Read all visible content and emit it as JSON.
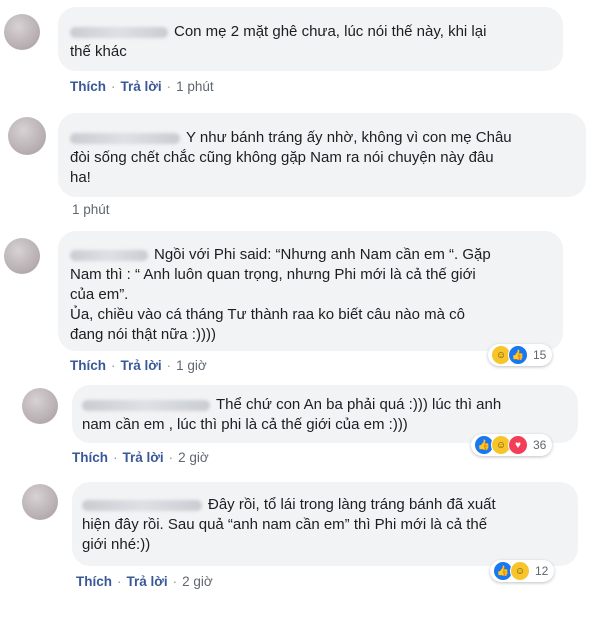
{
  "labels": {
    "like": "Thích",
    "reply": "Trả lời"
  },
  "comments": [
    {
      "text": "Con mẹ 2 mặt ghê chưa, lúc nói thế này, khi lại\nthế khác",
      "time": "1 phút",
      "show_actions": true
    },
    {
      "text": "Y như bánh tráng ấy nhờ, không vì con mẹ Châu\nđòi sống chết chắc cũng không gặp Nam ra nói chuyện này đâu\nha!",
      "time": "1 phút",
      "show_actions": false
    },
    {
      "text": "Ngồi với Phi said: “Nhưng anh Nam cần em “. Gặp\nNam thì : “ Anh luôn quan trọng, nhưng Phi mới là cả thế giới\ncủa em”.\nỦa, chiều vào cá tháng Tư thành raa ko biết câu nào mà cô\nđang nói thật nữa :))))",
      "time": "1 giờ",
      "show_actions": true,
      "reactions": {
        "icons": [
          "haha-icon",
          "like-icon"
        ],
        "count": "15"
      }
    },
    {
      "text": "Thể chứ con An ba phải quá :))) lúc thì anh\nnam cần em , lúc thì phi là cả thế giới của em :)))",
      "time": "2 giờ",
      "show_actions": true,
      "reactions": {
        "icons": [
          "like-icon",
          "haha-icon",
          "love-icon"
        ],
        "count": "36"
      }
    },
    {
      "text": "Đây rồi, tổ lái trong làng tráng bánh đã xuất\nhiện đây rồi. Sau quả “anh nam cần em” thì Phi mới là cả thế\ngiới nhé:))",
      "time": "2 giờ",
      "show_actions": true,
      "reactions": {
        "icons": [
          "like-icon",
          "haha-icon"
        ],
        "count": "12"
      }
    }
  ],
  "colors": {
    "bubble": "#f2f3f5",
    "link": "#385898",
    "text": "#1c1e21",
    "muted": "#606770"
  }
}
